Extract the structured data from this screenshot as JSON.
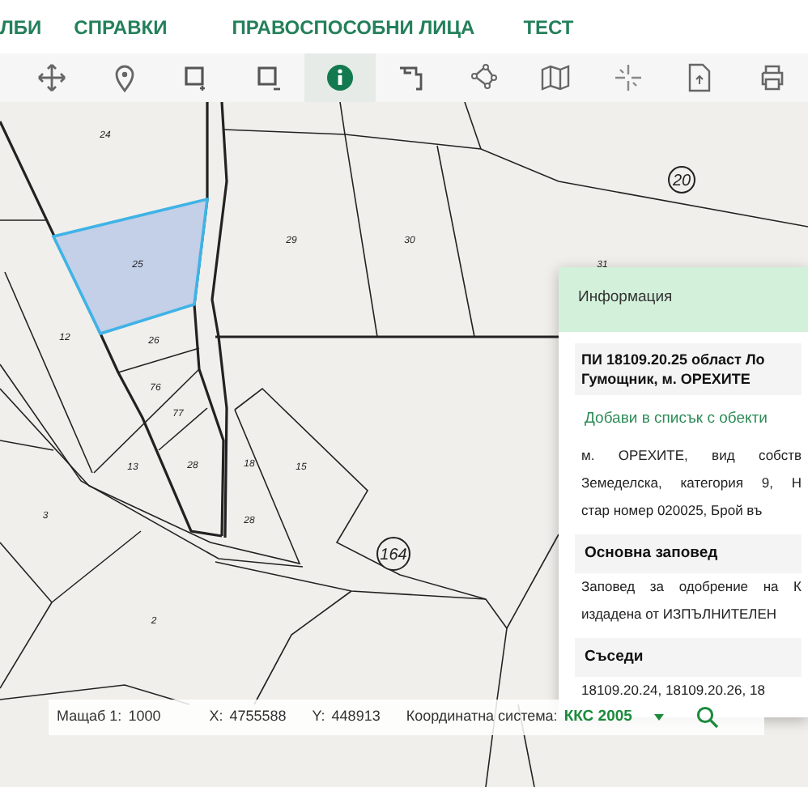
{
  "nav": [
    {
      "label": "ЛБИ"
    },
    {
      "label": "СПРАВКИ"
    },
    {
      "label": "ПРАВОСПОСОБНИ ЛИЦА"
    },
    {
      "label": "ТЕСТ"
    }
  ],
  "toolbar": [
    {
      "kind": "pan",
      "selected": false
    },
    {
      "kind": "pin",
      "selected": false
    },
    {
      "kind": "zoom-in-box",
      "selected": false
    },
    {
      "kind": "zoom-out-box",
      "selected": false
    },
    {
      "kind": "info",
      "selected": true
    },
    {
      "kind": "steps",
      "selected": false
    },
    {
      "kind": "nodes",
      "selected": false
    },
    {
      "kind": "map",
      "selected": false
    },
    {
      "kind": "crosshair",
      "selected": false
    },
    {
      "kind": "upload",
      "selected": false
    },
    {
      "kind": "print",
      "selected": false
    }
  ],
  "map": {
    "parcel_numbers": [
      {
        "text": "24",
        "kind": "plain"
      },
      {
        "text": "25",
        "kind": "plain"
      },
      {
        "text": "29",
        "kind": "plain"
      },
      {
        "text": "30",
        "kind": "plain"
      },
      {
        "text": "12",
        "kind": "plain"
      },
      {
        "text": "26",
        "kind": "plain"
      },
      {
        "text": "76",
        "kind": "plain"
      },
      {
        "text": "77",
        "kind": "plain"
      },
      {
        "text": "13",
        "kind": "plain"
      },
      {
        "text": "28",
        "kind": "plain"
      },
      {
        "text": "18",
        "kind": "plain"
      },
      {
        "text": "15",
        "kind": "plain"
      },
      {
        "text": "28",
        "kind": "plain"
      },
      {
        "text": "3",
        "kind": "plain"
      },
      {
        "text": "2",
        "kind": "plain"
      },
      {
        "text": "164",
        "kind": "circled"
      },
      {
        "text": "20",
        "kind": "circled"
      },
      {
        "text": "31",
        "kind": "plain"
      }
    ]
  },
  "info_panel": {
    "title": "Информация",
    "heading_lines": [
      "ПИ 18109.20.25 област Ло",
      "Гумощник, м. ОРЕХИТЕ"
    ],
    "add_link": "Добави в списък с обекти",
    "description_lines": [
      "м. ОРЕХИТЕ, вид собств",
      "Земеделска, категория 9, Н",
      "стар номер 020025, Брой въ"
    ],
    "sections": [
      {
        "title": "Основна заповед",
        "lines": [
          "Заповед за одобрение на К",
          "издадена от ИЗПЪЛНИТЕЛЕН"
        ]
      },
      {
        "title": "Съседи",
        "lines": [
          "18109.20.24, 18109.20.26, 18"
        ]
      }
    ]
  },
  "status_bar": {
    "scale_label": "Мащаб 1:",
    "scale_value": "1000",
    "x_label": "X:",
    "x_value": "4755588",
    "y_label": "Y:",
    "y_value": "448913",
    "crs_label": "Координатна система:",
    "crs_value": "ККС 2005"
  }
}
